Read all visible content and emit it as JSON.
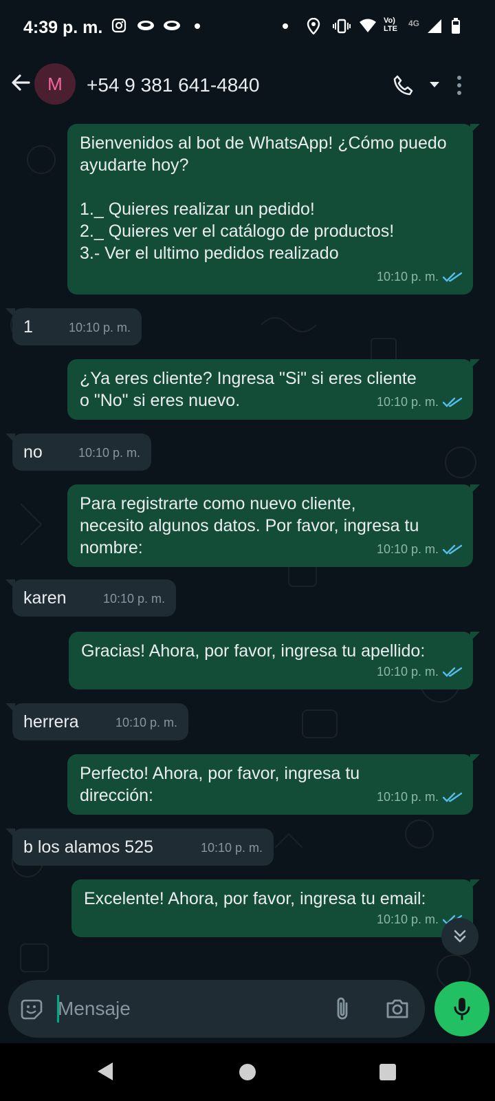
{
  "status_bar": {
    "time": "4:39 p. m.",
    "network": "4G",
    "volte": "Vo) LTE"
  },
  "header": {
    "avatar_letter": "M",
    "contact": "+54 9 381 641-4840"
  },
  "messages": [
    {
      "dir": "out",
      "text": "Bienvenidos al bot de WhatsApp! ¿Cómo puedo ayudarte hoy?\n\n1._ Quieres realizar un pedido!\n2._ Quieres ver el catálogo de productos!\n3.- Ver el ultimo pedidos realizado",
      "time": "10:10 p. m."
    },
    {
      "dir": "in",
      "text": "1",
      "time": "10:10 p. m."
    },
    {
      "dir": "out",
      "text": "¿Ya eres cliente? Ingresa \"Si\" si eres cliente\no \"No\" si eres nuevo.",
      "time": "10:10 p. m."
    },
    {
      "dir": "in",
      "text": "no",
      "time": "10:10 p. m."
    },
    {
      "dir": "out",
      "text": "Para registrarte como nuevo cliente,\nnecesito algunos datos. Por favor, ingresa tu\nnombre:",
      "time": "10:10 p. m."
    },
    {
      "dir": "in",
      "text": "karen",
      "time": "10:10 p. m."
    },
    {
      "dir": "out",
      "text": "Gracias! Ahora, por favor, ingresa tu apellido:",
      "time": "10:10 p. m."
    },
    {
      "dir": "in",
      "text": "herrera",
      "time": "10:10 p. m."
    },
    {
      "dir": "out",
      "text": "Perfecto! Ahora, por favor, ingresa tu\ndirección:",
      "time": "10:10 p. m."
    },
    {
      "dir": "in",
      "text": "b los alamos 525",
      "time": "10:10 p. m."
    },
    {
      "dir": "out",
      "text": "Excelente! Ahora, por favor, ingresa tu email:",
      "time": "10:10 p. m."
    }
  ],
  "composer": {
    "placeholder": "Mensaje"
  },
  "colors": {
    "outgoing_bubble": "#144d37",
    "incoming_bubble": "#202c33",
    "read_ticks": "#53bdeb",
    "mic_button": "#21c063"
  },
  "icons": {
    "back": "arrow-left-icon",
    "call": "phone-icon",
    "more": "more-vertical-icon",
    "emoji": "emoji-icon",
    "attach": "paperclip-icon",
    "camera": "camera-icon",
    "mic": "mic-icon",
    "scroll": "chevrons-down-icon"
  }
}
